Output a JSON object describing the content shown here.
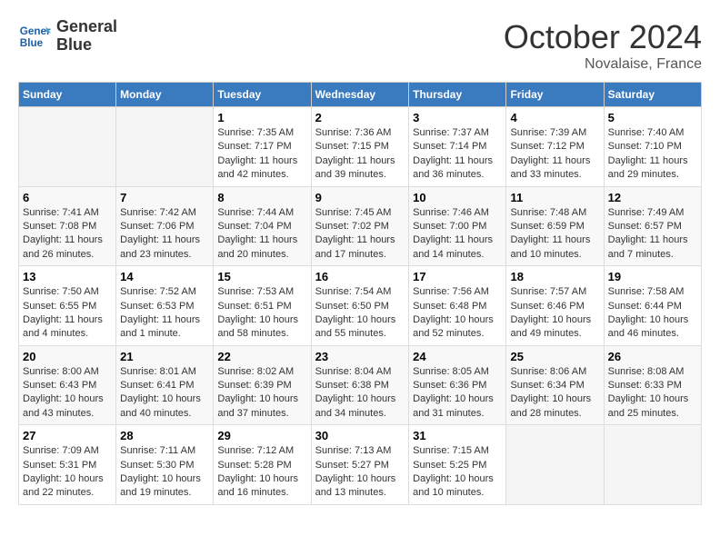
{
  "header": {
    "logo_line1": "General",
    "logo_line2": "Blue",
    "month": "October 2024",
    "location": "Novalaise, France"
  },
  "weekdays": [
    "Sunday",
    "Monday",
    "Tuesday",
    "Wednesday",
    "Thursday",
    "Friday",
    "Saturday"
  ],
  "weeks": [
    [
      {
        "day": "",
        "info": ""
      },
      {
        "day": "",
        "info": ""
      },
      {
        "day": "1",
        "info": "Sunrise: 7:35 AM\nSunset: 7:17 PM\nDaylight: 11 hours and 42 minutes."
      },
      {
        "day": "2",
        "info": "Sunrise: 7:36 AM\nSunset: 7:15 PM\nDaylight: 11 hours and 39 minutes."
      },
      {
        "day": "3",
        "info": "Sunrise: 7:37 AM\nSunset: 7:14 PM\nDaylight: 11 hours and 36 minutes."
      },
      {
        "day": "4",
        "info": "Sunrise: 7:39 AM\nSunset: 7:12 PM\nDaylight: 11 hours and 33 minutes."
      },
      {
        "day": "5",
        "info": "Sunrise: 7:40 AM\nSunset: 7:10 PM\nDaylight: 11 hours and 29 minutes."
      }
    ],
    [
      {
        "day": "6",
        "info": "Sunrise: 7:41 AM\nSunset: 7:08 PM\nDaylight: 11 hours and 26 minutes."
      },
      {
        "day": "7",
        "info": "Sunrise: 7:42 AM\nSunset: 7:06 PM\nDaylight: 11 hours and 23 minutes."
      },
      {
        "day": "8",
        "info": "Sunrise: 7:44 AM\nSunset: 7:04 PM\nDaylight: 11 hours and 20 minutes."
      },
      {
        "day": "9",
        "info": "Sunrise: 7:45 AM\nSunset: 7:02 PM\nDaylight: 11 hours and 17 minutes."
      },
      {
        "day": "10",
        "info": "Sunrise: 7:46 AM\nSunset: 7:00 PM\nDaylight: 11 hours and 14 minutes."
      },
      {
        "day": "11",
        "info": "Sunrise: 7:48 AM\nSunset: 6:59 PM\nDaylight: 11 hours and 10 minutes."
      },
      {
        "day": "12",
        "info": "Sunrise: 7:49 AM\nSunset: 6:57 PM\nDaylight: 11 hours and 7 minutes."
      }
    ],
    [
      {
        "day": "13",
        "info": "Sunrise: 7:50 AM\nSunset: 6:55 PM\nDaylight: 11 hours and 4 minutes."
      },
      {
        "day": "14",
        "info": "Sunrise: 7:52 AM\nSunset: 6:53 PM\nDaylight: 11 hours and 1 minute."
      },
      {
        "day": "15",
        "info": "Sunrise: 7:53 AM\nSunset: 6:51 PM\nDaylight: 10 hours and 58 minutes."
      },
      {
        "day": "16",
        "info": "Sunrise: 7:54 AM\nSunset: 6:50 PM\nDaylight: 10 hours and 55 minutes."
      },
      {
        "day": "17",
        "info": "Sunrise: 7:56 AM\nSunset: 6:48 PM\nDaylight: 10 hours and 52 minutes."
      },
      {
        "day": "18",
        "info": "Sunrise: 7:57 AM\nSunset: 6:46 PM\nDaylight: 10 hours and 49 minutes."
      },
      {
        "day": "19",
        "info": "Sunrise: 7:58 AM\nSunset: 6:44 PM\nDaylight: 10 hours and 46 minutes."
      }
    ],
    [
      {
        "day": "20",
        "info": "Sunrise: 8:00 AM\nSunset: 6:43 PM\nDaylight: 10 hours and 43 minutes."
      },
      {
        "day": "21",
        "info": "Sunrise: 8:01 AM\nSunset: 6:41 PM\nDaylight: 10 hours and 40 minutes."
      },
      {
        "day": "22",
        "info": "Sunrise: 8:02 AM\nSunset: 6:39 PM\nDaylight: 10 hours and 37 minutes."
      },
      {
        "day": "23",
        "info": "Sunrise: 8:04 AM\nSunset: 6:38 PM\nDaylight: 10 hours and 34 minutes."
      },
      {
        "day": "24",
        "info": "Sunrise: 8:05 AM\nSunset: 6:36 PM\nDaylight: 10 hours and 31 minutes."
      },
      {
        "day": "25",
        "info": "Sunrise: 8:06 AM\nSunset: 6:34 PM\nDaylight: 10 hours and 28 minutes."
      },
      {
        "day": "26",
        "info": "Sunrise: 8:08 AM\nSunset: 6:33 PM\nDaylight: 10 hours and 25 minutes."
      }
    ],
    [
      {
        "day": "27",
        "info": "Sunrise: 7:09 AM\nSunset: 5:31 PM\nDaylight: 10 hours and 22 minutes."
      },
      {
        "day": "28",
        "info": "Sunrise: 7:11 AM\nSunset: 5:30 PM\nDaylight: 10 hours and 19 minutes."
      },
      {
        "day": "29",
        "info": "Sunrise: 7:12 AM\nSunset: 5:28 PM\nDaylight: 10 hours and 16 minutes."
      },
      {
        "day": "30",
        "info": "Sunrise: 7:13 AM\nSunset: 5:27 PM\nDaylight: 10 hours and 13 minutes."
      },
      {
        "day": "31",
        "info": "Sunrise: 7:15 AM\nSunset: 5:25 PM\nDaylight: 10 hours and 10 minutes."
      },
      {
        "day": "",
        "info": ""
      },
      {
        "day": "",
        "info": ""
      }
    ]
  ]
}
